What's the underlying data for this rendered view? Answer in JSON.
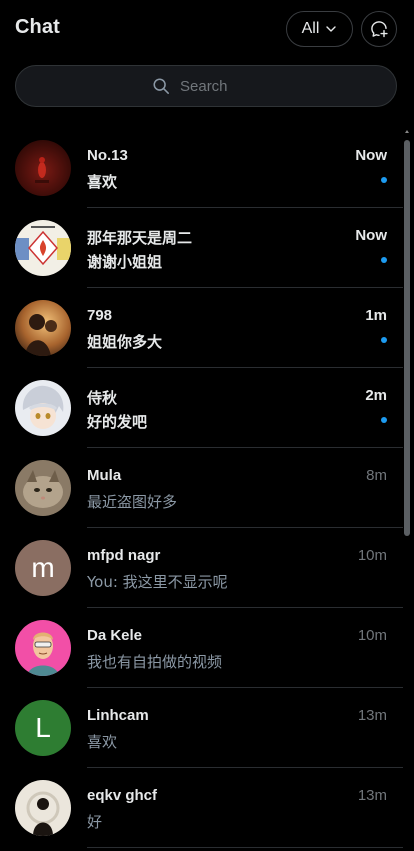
{
  "header": {
    "title": "Chat",
    "filter_label": "All",
    "new_chat_icon": "new-chat-icon"
  },
  "search": {
    "placeholder": "Search",
    "icon": "search-icon"
  },
  "colors": {
    "background": "#000000",
    "unread_dot": "#1d9bf0",
    "muted_text": "#71767b",
    "divider": "#2a2d31"
  },
  "chats": [
    {
      "name": "No.13",
      "preview": "喜欢",
      "time": "Now",
      "unread": true,
      "avatar": "photo"
    },
    {
      "name": "那年那天是周二",
      "preview": "谢谢小姐姐",
      "time": "Now",
      "unread": true,
      "avatar": "photo"
    },
    {
      "name": "798",
      "preview": "姐姐你多大",
      "time": "1m",
      "unread": true,
      "avatar": "photo"
    },
    {
      "name": "侍秋",
      "preview": "好的发吧",
      "time": "2m",
      "unread": true,
      "avatar": "photo"
    },
    {
      "name": "Mula",
      "preview": "最近盗图好多",
      "time": "8m",
      "unread": false,
      "avatar": "photo"
    },
    {
      "name": "mfpd nagr",
      "preview": "You: 我这里不显示呢",
      "time": "10m",
      "unread": false,
      "avatar": "m",
      "avatar_color": "#8a6e62"
    },
    {
      "name": "Da Kele",
      "preview": "我也有自拍做的视频",
      "time": "10m",
      "unread": false,
      "avatar": "photo"
    },
    {
      "name": "Linhcam",
      "preview": "喜欢",
      "time": "13m",
      "unread": false,
      "avatar": "L",
      "avatar_color": "#2e7d32"
    },
    {
      "name": "eqkv ghcf",
      "preview": "好",
      "time": "13m",
      "unread": false,
      "avatar": "photo"
    }
  ]
}
